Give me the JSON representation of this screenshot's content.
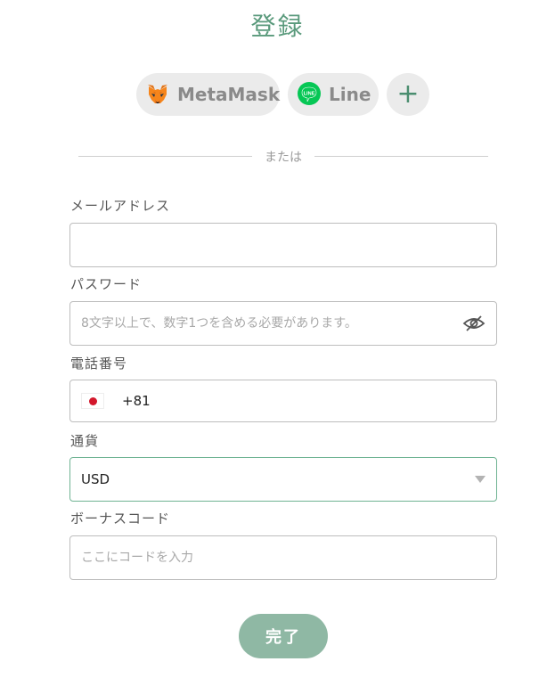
{
  "title": "登録",
  "social": {
    "metamask_label": "MetaMask",
    "line_label": "Line",
    "line_icon_text": "LINE",
    "more_label": "+"
  },
  "divider_text": "または",
  "email": {
    "label": "メールアドレス",
    "value": "",
    "placeholder": ""
  },
  "password": {
    "label": "パスワード",
    "value": "",
    "placeholder": "8文字以上で、数字1つを含める必要があります。"
  },
  "phone": {
    "label": "電話番号",
    "code": "+81",
    "country_flag": "japan-flag-icon"
  },
  "currency": {
    "label": "通貨",
    "value": "USD"
  },
  "bonus": {
    "label": "ボーナスコード",
    "value": "",
    "placeholder": "ここにコードを入力"
  },
  "submit_label": "完了",
  "colors": {
    "accent": "#5a9a7c",
    "button": "#8fb8a4",
    "select_border": "#6fb393",
    "line_green": "#06c755"
  }
}
